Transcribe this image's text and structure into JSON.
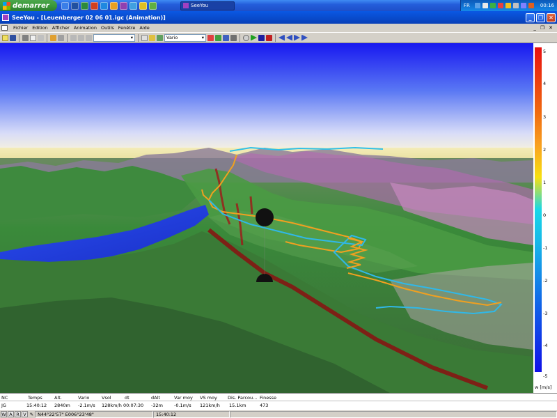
{
  "taskbar": {
    "start_label": "demarrer",
    "task_button_label": "SeeYou",
    "language": "FR",
    "clock": "00:16"
  },
  "window": {
    "title": "SeeYou - [Leuenberger 02 06 01.igc (Animation)]"
  },
  "menu": {
    "items": [
      "Fichier",
      "Edition",
      "Afficher",
      "Animation",
      "Outils",
      "Fenêtre",
      "Aide"
    ]
  },
  "toolbar": {
    "zoom_combo_value": "",
    "display_combo_value": "Vario"
  },
  "legend": {
    "ticks": [
      "5",
      "4",
      "3",
      "2",
      "1",
      "0",
      "-1",
      "-2",
      "-3",
      "-4",
      "-5"
    ],
    "unit": "w [m/s]"
  },
  "stats": {
    "headers": [
      "NC",
      "Temps",
      "Alt.",
      "Vario",
      "Vsol",
      "dt",
      "dAlt",
      "Var moy",
      "VS moy",
      "Dis. Parcou...",
      "Finesse"
    ],
    "values": [
      "JG",
      "15:40:12",
      "2840m",
      "-2.1m/s",
      "128km/h",
      "00:07:30",
      "-32m",
      "-0.1m/s",
      "121km/h",
      "15.1km",
      "473"
    ]
  },
  "statusbar": {
    "buttons": [
      "W",
      "A",
      "R",
      "V"
    ],
    "coordinates": "N44°22'57\"  E006°23'48\"",
    "time": "15:40:12"
  },
  "colors": {
    "sky_top": "#1c1cf0",
    "terrain_green": "#3c9a3c",
    "lake_blue": "#1a3de8",
    "track_cyan": "#20b8e8",
    "track_orange": "#f0a020"
  }
}
